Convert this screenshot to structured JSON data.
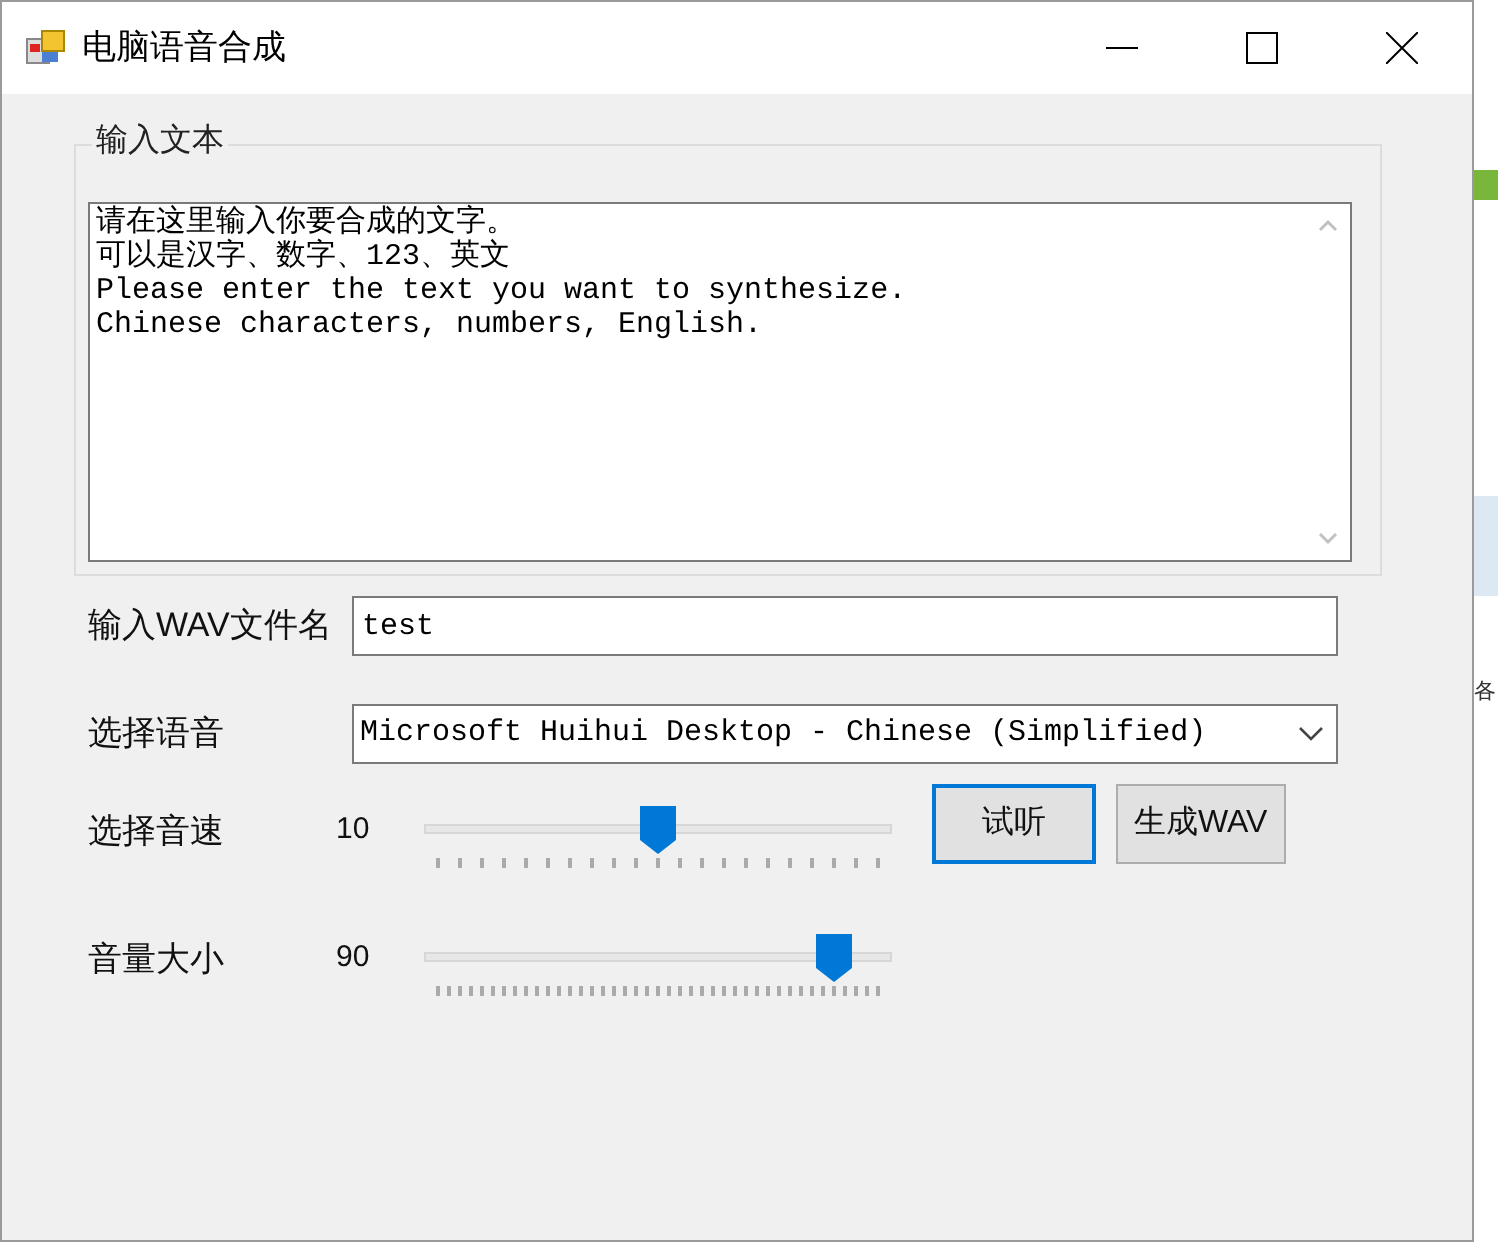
{
  "window": {
    "title": "电脑语音合成"
  },
  "text_group": {
    "title": "输入文本",
    "lines": [
      "请在这里输入你要合成的文字。",
      "可以是汉字、数字、123、英文",
      "Please enter the text you want to synthesize.",
      "Chinese characters, numbers, English."
    ]
  },
  "filename": {
    "label": "输入WAV文件名",
    "value": "test"
  },
  "voice": {
    "label": "选择语音",
    "value": "Microsoft Huihui Desktop - Chinese (Simplified)"
  },
  "sliders": [
    {
      "label": "选择音速",
      "reading": "10",
      "level": 0.5,
      "kind": "sparse"
    },
    {
      "label": "音量大小",
      "reading": "90",
      "level": 0.88,
      "kind": "dense"
    }
  ],
  "buttons": [
    {
      "label": "试听",
      "selected": true
    },
    {
      "label": "生成WAV",
      "selected": false
    }
  ],
  "background_text": "各"
}
